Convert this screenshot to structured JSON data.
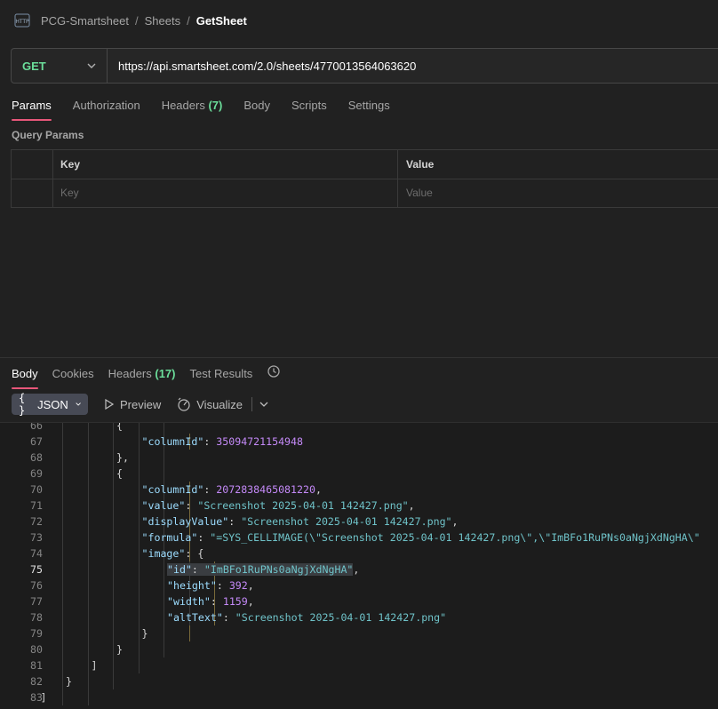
{
  "breadcrumb": {
    "icon": "http-icon",
    "items": [
      "PCG-Smartsheet",
      "Sheets",
      "GetSheet"
    ],
    "separator": "/"
  },
  "request": {
    "method": "GET",
    "url": "https://api.smartsheet.com/2.0/sheets/4770013564063620"
  },
  "request_tabs": [
    {
      "label": "Params",
      "active": true
    },
    {
      "label": "Authorization"
    },
    {
      "label": "Headers",
      "count": "(7)"
    },
    {
      "label": "Body"
    },
    {
      "label": "Scripts"
    },
    {
      "label": "Settings"
    }
  ],
  "query_params": {
    "title": "Query Params",
    "headers": [
      "Key",
      "Value"
    ],
    "placeholder_key": "Key",
    "placeholder_value": "Value"
  },
  "response_tabs": [
    {
      "label": "Body",
      "active": true
    },
    {
      "label": "Cookies"
    },
    {
      "label": "Headers",
      "count": "(17)"
    },
    {
      "label": "Test Results"
    }
  ],
  "toolbar": {
    "format": "JSON",
    "format_icon": "{ }",
    "preview": "Preview",
    "visualize": "Visualize"
  },
  "code_lines": [
    {
      "n": "66",
      "indent": 6,
      "parts": [
        [
          "p",
          "{"
        ]
      ]
    },
    {
      "n": "67",
      "indent": 7,
      "parts": [
        [
          "k",
          "\"columnId\""
        ],
        [
          "p",
          ": "
        ],
        [
          "n",
          "35094721154948"
        ]
      ]
    },
    {
      "n": "68",
      "indent": 6,
      "parts": [
        [
          "p",
          "},"
        ]
      ]
    },
    {
      "n": "69",
      "indent": 6,
      "parts": [
        [
          "p",
          "{"
        ]
      ]
    },
    {
      "n": "70",
      "indent": 7,
      "parts": [
        [
          "k",
          "\"columnId\""
        ],
        [
          "p",
          ": "
        ],
        [
          "n",
          "2072838465081220"
        ],
        [
          "p",
          ","
        ]
      ]
    },
    {
      "n": "71",
      "indent": 7,
      "parts": [
        [
          "k",
          "\"value\""
        ],
        [
          "p",
          ": "
        ],
        [
          "s",
          "\"Screenshot 2025-04-01 142427.png\""
        ],
        [
          "p",
          ","
        ]
      ]
    },
    {
      "n": "72",
      "indent": 7,
      "parts": [
        [
          "k",
          "\"displayValue\""
        ],
        [
          "p",
          ": "
        ],
        [
          "s",
          "\"Screenshot 2025-04-01 142427.png\""
        ],
        [
          "p",
          ","
        ]
      ]
    },
    {
      "n": "73",
      "indent": 7,
      "parts": [
        [
          "k",
          "\"formula\""
        ],
        [
          "p",
          ": "
        ],
        [
          "s",
          "\"=SYS_CELLIMAGE(\\\"Screenshot 2025-04-01 142427.png\\\",\\\"ImBFo1RuPNs0aNgjXdNgHA\\\""
        ]
      ]
    },
    {
      "n": "74",
      "indent": 7,
      "parts": [
        [
          "k",
          "\"image\""
        ],
        [
          "p",
          ": {"
        ]
      ]
    },
    {
      "n": "75",
      "indent": 8,
      "active": true,
      "parts": [
        [
          "k",
          "\"id\""
        ],
        [
          "p",
          ": "
        ],
        [
          "s",
          "\"ImBFo1RuPNs0aNgjXdNgHA\""
        ],
        [
          "p",
          ","
        ]
      ]
    },
    {
      "n": "76",
      "indent": 8,
      "parts": [
        [
          "k",
          "\"height\""
        ],
        [
          "p",
          ": "
        ],
        [
          "n",
          "392"
        ],
        [
          "p",
          ","
        ]
      ]
    },
    {
      "n": "77",
      "indent": 8,
      "parts": [
        [
          "k",
          "\"width\""
        ],
        [
          "p",
          ": "
        ],
        [
          "n",
          "1159"
        ],
        [
          "p",
          ","
        ]
      ]
    },
    {
      "n": "78",
      "indent": 8,
      "parts": [
        [
          "k",
          "\"altText\""
        ],
        [
          "p",
          ": "
        ],
        [
          "s",
          "\"Screenshot 2025-04-01 142427.png\""
        ]
      ]
    },
    {
      "n": "79",
      "indent": 7,
      "parts": [
        [
          "p",
          "}"
        ]
      ]
    },
    {
      "n": "80",
      "indent": 6,
      "parts": [
        [
          "p",
          "}"
        ]
      ]
    },
    {
      "n": "81",
      "indent": 5,
      "parts": [
        [
          "p",
          "]"
        ]
      ]
    },
    {
      "n": "82",
      "indent": 4,
      "parts": [
        [
          "p",
          "}"
        ]
      ]
    },
    {
      "n": "83",
      "indent": 3,
      "parts": [
        [
          "p",
          "]"
        ]
      ]
    }
  ]
}
